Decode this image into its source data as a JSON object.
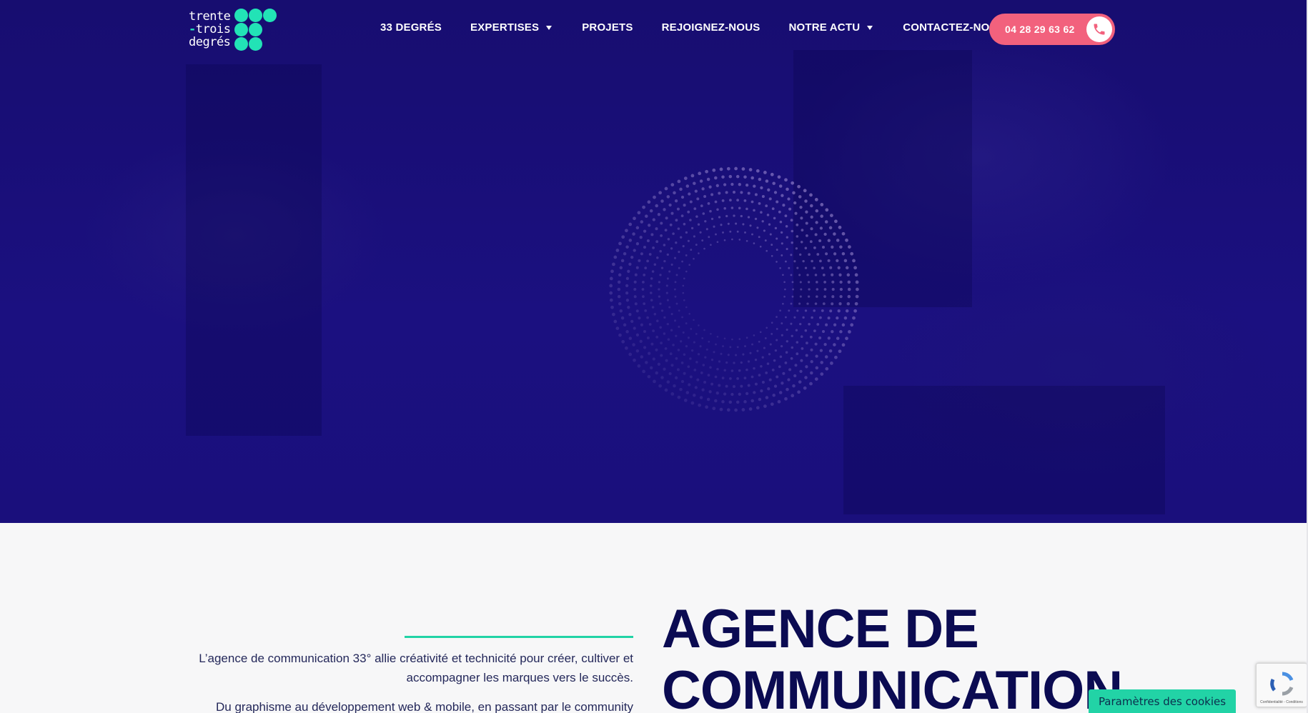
{
  "logo": {
    "lines": [
      "trente",
      "trois",
      "degrés"
    ],
    "dash": "-"
  },
  "colors": {
    "hero_bg": "#1a0f7a",
    "accent_green": "#22e3b6",
    "cta_pink": "#f2617d",
    "title_navy": "#0b0b52"
  },
  "nav": {
    "items": [
      {
        "label": "33 DEGRÉS",
        "dropdown": false
      },
      {
        "label": "EXPERTISES",
        "dropdown": true
      },
      {
        "label": "PROJETS",
        "dropdown": false
      },
      {
        "label": "REJOIGNEZ-NOUS",
        "dropdown": false
      },
      {
        "label": "NOTRE ACTU",
        "dropdown": true
      },
      {
        "label": "CONTACTEZ-NOUS",
        "dropdown": false
      }
    ],
    "phone": {
      "number": "04 28 29 63 62",
      "icon": "phone-icon"
    }
  },
  "content": {
    "intro_paragraphs": [
      "L’agence de communication 33° allie créativité et technicité pour créer, cultiver et accompagner les marques vers le succès.",
      "Du graphisme au développement web & mobile, en passant par le community"
    ],
    "title_lines": [
      "AGENCE DE",
      "COMMUNICATION"
    ]
  },
  "widgets": {
    "cookie_button": "Paramètres des cookies",
    "recaptcha_footer": "Confidentialité - Conditions",
    "recaptcha_icon": "recaptcha-icon"
  }
}
